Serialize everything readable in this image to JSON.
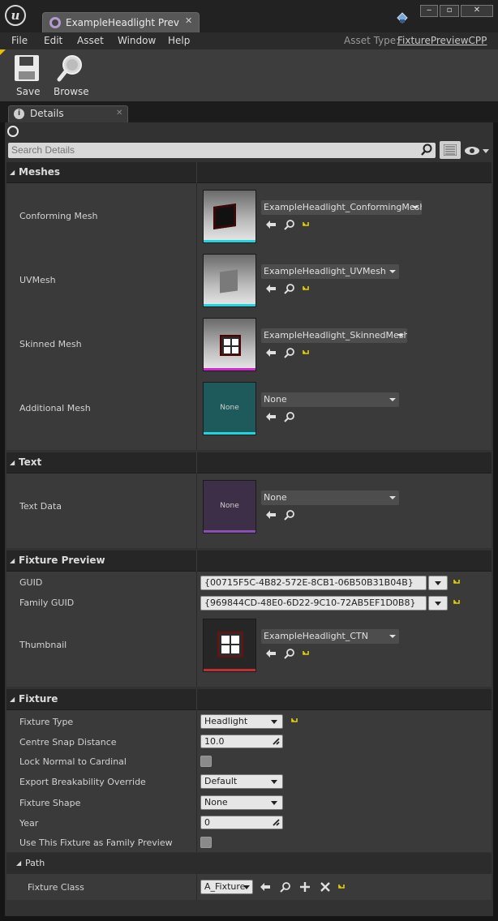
{
  "window": {
    "tab_title": "ExampleHeadlight Preview",
    "logo_text": "u",
    "min_glyph": "‒",
    "max_glyph": "▫",
    "close_glyph": "✕",
    "tab_close_glyph": "✕"
  },
  "menu": {
    "items": [
      "File",
      "Edit",
      "Asset",
      "Window",
      "Help"
    ],
    "asset_type_label": "Asset Type:",
    "asset_type_value": "FixturePreviewCPP"
  },
  "toolbar": {
    "save_label": "Save",
    "browse_label": "Browse"
  },
  "details": {
    "tab_label": "Details",
    "tab_icon": "i",
    "tab_close": "✕",
    "search_placeholder": "Search Details"
  },
  "categories": {
    "meshes": "Meshes",
    "text": "Text",
    "fixture_preview": "Fixture Preview",
    "fixture": "Fixture",
    "path": "Path"
  },
  "meshes": {
    "conforming_label": "Conforming Mesh",
    "conforming_value": "ExampleHeadlight_ConformingMesh",
    "uv_label": "UVMesh",
    "uv_value": "ExampleHeadlight_UVMesh",
    "skinned_label": "Skinned Mesh",
    "skinned_value": "ExampleHeadlight_SkinnedMesh",
    "additional_label": "Additional Mesh",
    "additional_value": "None",
    "additional_thumb_text": "None"
  },
  "text_section": {
    "text_data_label": "Text Data",
    "text_data_value": "None",
    "thumb_text": "None"
  },
  "fixture_preview": {
    "guid_label": "GUID",
    "guid_value": "{00715F5C-4B82-572E-8CB1-06B50B31B04B}",
    "family_guid_label": "Family GUID",
    "family_guid_value": "{969844CD-48E0-6D22-9C10-72AB5EF1D0B8}",
    "thumbnail_label": "Thumbnail",
    "thumbnail_value": "ExampleHeadlight_CTN"
  },
  "fixture": {
    "type_label": "Fixture Type",
    "type_value": "Headlight",
    "centre_snap_label": "Centre Snap Distance",
    "centre_snap_value": "10.0",
    "lock_normal_label": "Lock Normal to Cardinal",
    "lock_normal_checked": false,
    "export_label": "Export Breakability Override",
    "export_value": "Default",
    "shape_label": "Fixture Shape",
    "shape_value": "None",
    "year_label": "Year",
    "year_value": "0",
    "family_preview_label": "Use This Fixture as Family Preview",
    "family_preview_checked": false
  },
  "path": {
    "class_label": "Fixture Class",
    "class_value": "A_Fixture"
  },
  "colors": {
    "mesh_bar": "#1fd6e0",
    "skinned_bar": "#d02ad0",
    "text_bar": "#8a4fb0",
    "thumbnail_bar": "#c03030",
    "reset_arrow": "#e6d000",
    "additional_thumb_bg": "#1e5a5c",
    "text_thumb_bg": "#3e2f48"
  }
}
